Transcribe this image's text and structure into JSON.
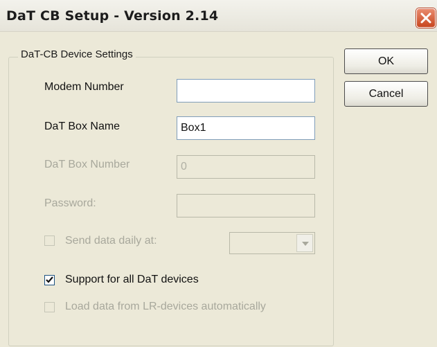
{
  "window": {
    "title": "DaT CB Setup - Version 2.14"
  },
  "group": {
    "legend": "DaT-CB Device Settings"
  },
  "fields": {
    "modem_number": {
      "label": "Modem Number",
      "value": ""
    },
    "box_name": {
      "label": "DaT Box Name",
      "value": "Box1"
    },
    "box_number": {
      "label": "DaT Box Number",
      "value": "0"
    },
    "password": {
      "label": "Password:",
      "value": ""
    }
  },
  "checkboxes": {
    "send_daily": {
      "label": "Send data daily at:",
      "checked": false,
      "enabled": false
    },
    "support_all": {
      "label": "Support for all DaT devices",
      "checked": true,
      "enabled": true
    },
    "load_lr": {
      "label": "Load data from LR-devices automatically",
      "checked": false,
      "enabled": false
    }
  },
  "send_time": {
    "selected": ""
  },
  "buttons": {
    "ok": "OK",
    "cancel": "Cancel"
  },
  "icons": {
    "close": "close-icon",
    "check": "checkmark-icon",
    "dropdown": "chevron-down-icon"
  },
  "colors": {
    "close_button": "#d6512b",
    "dialog_background": "#ece9d8"
  }
}
